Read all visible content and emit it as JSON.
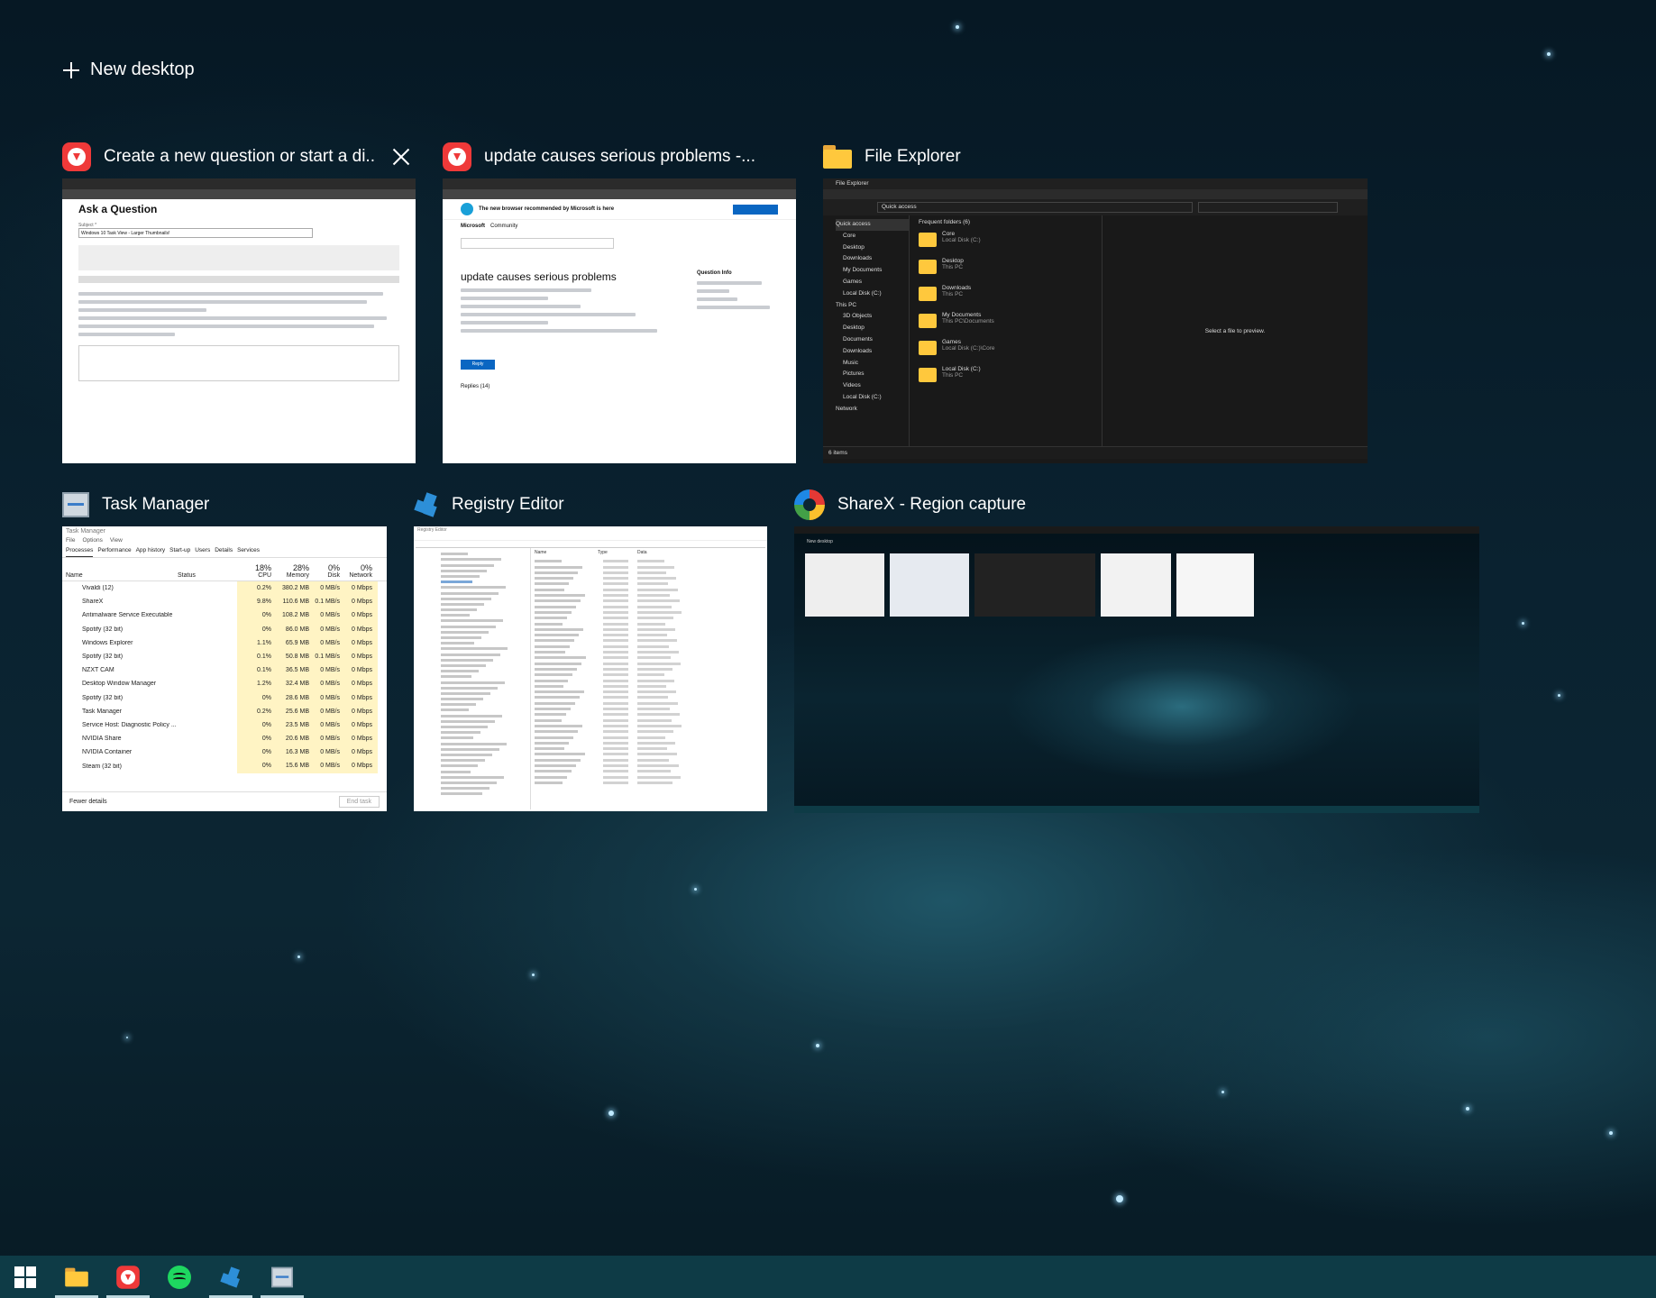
{
  "new_desktop": {
    "label": "New desktop",
    "icon": "plus-icon"
  },
  "windows": [
    {
      "title": "Create a new question or start a di...",
      "app": "Vivaldi",
      "icon": "vivaldi-icon",
      "has_close": true,
      "thumb": {
        "heading": "Ask a Question",
        "subject_value": "Windows 10 Task View - Larger Thumbnails!"
      }
    },
    {
      "title": "update causes serious problems -...",
      "app": "Vivaldi",
      "icon": "vivaldi-icon",
      "thumb": {
        "banner": "The new browser recommended by Microsoft is here",
        "brand": "Microsoft",
        "community": "Community",
        "heading": "update causes serious problems",
        "sidebar_heading": "Question Info",
        "reply_button": "Reply",
        "replies": "Replies (14)"
      }
    },
    {
      "title": "File Explorer",
      "app": "File Explorer",
      "icon": "folder-icon",
      "thumb": {
        "window_title": "File Explorer",
        "address": "Quick access",
        "section": "Frequent folders (6)",
        "empty_hint": "Select a file to preview.",
        "status": "6 items",
        "nav": [
          "Quick access",
          "Core",
          "Desktop",
          "Downloads",
          "My Documents",
          "Games",
          "Local Disk (C:)",
          "This PC",
          "3D Objects",
          "Desktop",
          "Documents",
          "Downloads",
          "Music",
          "Pictures",
          "Videos",
          "Local Disk (C:)",
          "Network"
        ],
        "folders": [
          {
            "name": "Core",
            "sub": "Local Disk (C:)"
          },
          {
            "name": "Desktop",
            "sub": "This PC"
          },
          {
            "name": "Downloads",
            "sub": "This PC"
          },
          {
            "name": "My Documents",
            "sub": "This PC\\Documents"
          },
          {
            "name": "Games",
            "sub": "Local Disk (C:)\\Core"
          },
          {
            "name": "Local Disk (C:)",
            "sub": "This PC"
          }
        ]
      }
    },
    {
      "title": "Task Manager",
      "app": "Task Manager",
      "icon": "task-manager-icon",
      "thumb": {
        "window_title": "Task Manager",
        "menu": [
          "File",
          "Options",
          "View"
        ],
        "tabs": [
          "Processes",
          "Performance",
          "App history",
          "Start-up",
          "Users",
          "Details",
          "Services"
        ],
        "headers": {
          "name": "Name",
          "status": "Status",
          "cpu": "18%",
          "cpu_label": "CPU",
          "mem": "28%",
          "mem_label": "Memory",
          "disk": "0%",
          "disk_label": "Disk",
          "net": "0%",
          "net_label": "Network"
        },
        "rows": [
          {
            "name": "Vivaldi (12)",
            "cpu": "0.2%",
            "mem": "380.2 MB",
            "disk": "0 MB/s",
            "net": "0 Mbps"
          },
          {
            "name": "ShareX",
            "cpu": "9.8%",
            "mem": "110.6 MB",
            "disk": "0.1 MB/s",
            "net": "0 Mbps"
          },
          {
            "name": "Antimalware Service Executable",
            "cpu": "0%",
            "mem": "108.2 MB",
            "disk": "0 MB/s",
            "net": "0 Mbps"
          },
          {
            "name": "Spotify (32 bit)",
            "cpu": "0%",
            "mem": "86.0 MB",
            "disk": "0 MB/s",
            "net": "0 Mbps"
          },
          {
            "name": "Windows Explorer",
            "cpu": "1.1%",
            "mem": "65.9 MB",
            "disk": "0 MB/s",
            "net": "0 Mbps"
          },
          {
            "name": "Spotify (32 bit)",
            "cpu": "0.1%",
            "mem": "50.8 MB",
            "disk": "0.1 MB/s",
            "net": "0 Mbps"
          },
          {
            "name": "NZXT CAM",
            "cpu": "0.1%",
            "mem": "36.5 MB",
            "disk": "0 MB/s",
            "net": "0 Mbps"
          },
          {
            "name": "Desktop Window Manager",
            "cpu": "1.2%",
            "mem": "32.4 MB",
            "disk": "0 MB/s",
            "net": "0 Mbps"
          },
          {
            "name": "Spotify (32 bit)",
            "cpu": "0%",
            "mem": "28.6 MB",
            "disk": "0 MB/s",
            "net": "0 Mbps"
          },
          {
            "name": "Task Manager",
            "cpu": "0.2%",
            "mem": "25.6 MB",
            "disk": "0 MB/s",
            "net": "0 Mbps"
          },
          {
            "name": "Service Host: Diagnostic Policy ...",
            "cpu": "0%",
            "mem": "23.5 MB",
            "disk": "0 MB/s",
            "net": "0 Mbps"
          },
          {
            "name": "NVIDIA Share",
            "cpu": "0%",
            "mem": "20.6 MB",
            "disk": "0 MB/s",
            "net": "0 Mbps"
          },
          {
            "name": "NVIDIA Container",
            "cpu": "0%",
            "mem": "16.3 MB",
            "disk": "0 MB/s",
            "net": "0 Mbps"
          },
          {
            "name": "Steam (32 bit)",
            "cpu": "0%",
            "mem": "15.6 MB",
            "disk": "0 MB/s",
            "net": "0 Mbps"
          }
        ],
        "footer": "Fewer details",
        "end_task": "End task"
      }
    },
    {
      "title": "Registry Editor",
      "app": "Registry Editor",
      "icon": "registry-editor-icon",
      "thumb": {
        "window_title": "Registry Editor",
        "cols": [
          "Name",
          "Type",
          "Data"
        ]
      }
    },
    {
      "title": "ShareX - Region capture",
      "app": "ShareX",
      "icon": "sharex-icon",
      "thumb": {
        "label": "New desktop"
      }
    }
  ],
  "taskbar": {
    "items": [
      {
        "name": "start-button",
        "icon": "windows-logo-icon"
      },
      {
        "name": "file-explorer",
        "icon": "folder-icon",
        "active": true
      },
      {
        "name": "vivaldi",
        "icon": "vivaldi-icon",
        "active": true
      },
      {
        "name": "spotify",
        "icon": "spotify-icon"
      },
      {
        "name": "registry-editor",
        "icon": "registry-editor-icon",
        "active": true
      },
      {
        "name": "task-manager",
        "icon": "task-manager-icon",
        "active": true
      }
    ]
  }
}
